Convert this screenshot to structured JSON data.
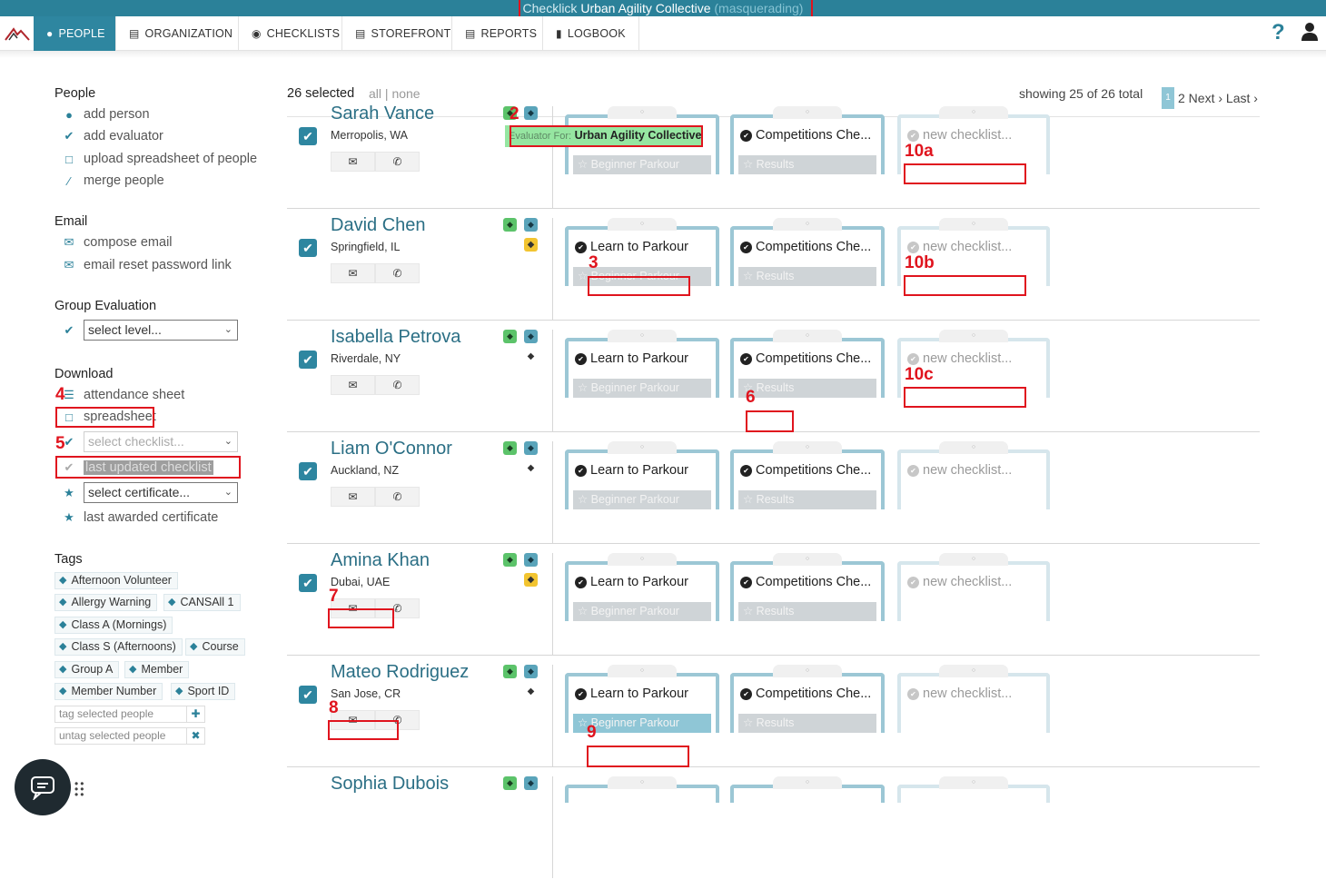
{
  "topbar": {
    "prefix": "Checklick",
    "org": "Urban Agility Collective",
    "masq": "(masquerading)"
  },
  "nav": {
    "tabs": [
      {
        "label": "PEOPLE",
        "icon": "people-icon"
      },
      {
        "label": "ORGANIZATION",
        "icon": "building-icon"
      },
      {
        "label": "CHECKLISTS",
        "icon": "globe-icon"
      },
      {
        "label": "STOREFRONT",
        "icon": "cart-icon"
      },
      {
        "label": "REPORTS",
        "icon": "chart-icon"
      },
      {
        "label": "LOGBOOK",
        "icon": "book-icon"
      }
    ],
    "help": "?"
  },
  "sidebar": {
    "people_title": "People",
    "people_items": [
      "add person",
      "add evaluator",
      "upload spreadsheet of people",
      "merge people"
    ],
    "email_title": "Email",
    "email_items": [
      "compose email",
      "email reset password link"
    ],
    "group_title": "Group Evaluation",
    "group_select": "select level...",
    "download_title": "Download",
    "download_items": [
      "attendance sheet",
      "spreadsheet"
    ],
    "download_checklist_select": "select checklist...",
    "last_updated": "last updated checklist",
    "certificate_select": "select certificate...",
    "last_awarded": "last awarded certificate",
    "tags_title": "Tags",
    "tags": [
      "Afternoon Volunteer",
      "Allergy Warning",
      "CANSAll 1",
      "Class A (Mornings)",
      "Class S (Afternoons)",
      "Course",
      "Group A",
      "Member",
      "Member Number",
      "Sport ID"
    ],
    "tag_placeholder": "tag selected people",
    "untag_placeholder": "untag selected people"
  },
  "list": {
    "selected": "26 selected",
    "all": "all",
    "sep": "|",
    "none": "none",
    "showing": "showing 25 of 26 total",
    "page": "1",
    "next": "2 Next › Last ›"
  },
  "eval_tip": {
    "label": "Evaluator For:",
    "org": "Urban Agility Collective"
  },
  "people": [
    {
      "name": "Sarah Vance",
      "loc": "Merropolis, WA"
    },
    {
      "name": "David Chen",
      "loc": "Springfield, IL"
    },
    {
      "name": "Isabella Petrova",
      "loc": "Riverdale, NY"
    },
    {
      "name": "Liam O'Connor",
      "loc": "Auckland, NZ"
    },
    {
      "name": "Amina Khan",
      "loc": "Dubai, UAE"
    },
    {
      "name": "Mateo Rodriguez",
      "loc": "San Jose, CR"
    },
    {
      "name": "Sophia Dubois",
      "loc": ""
    }
  ],
  "cards": {
    "c1_title": "Learn to Parkour",
    "c1_foot": "☆ Beginner Parkour",
    "c2_title": "Competitions Che...",
    "c2_foot": "☆ Results",
    "c3_title": "new checklist..."
  },
  "annotations": [
    "2",
    "3",
    "4",
    "5",
    "6",
    "7",
    "8",
    "9",
    "10a",
    "10b",
    "10c"
  ]
}
